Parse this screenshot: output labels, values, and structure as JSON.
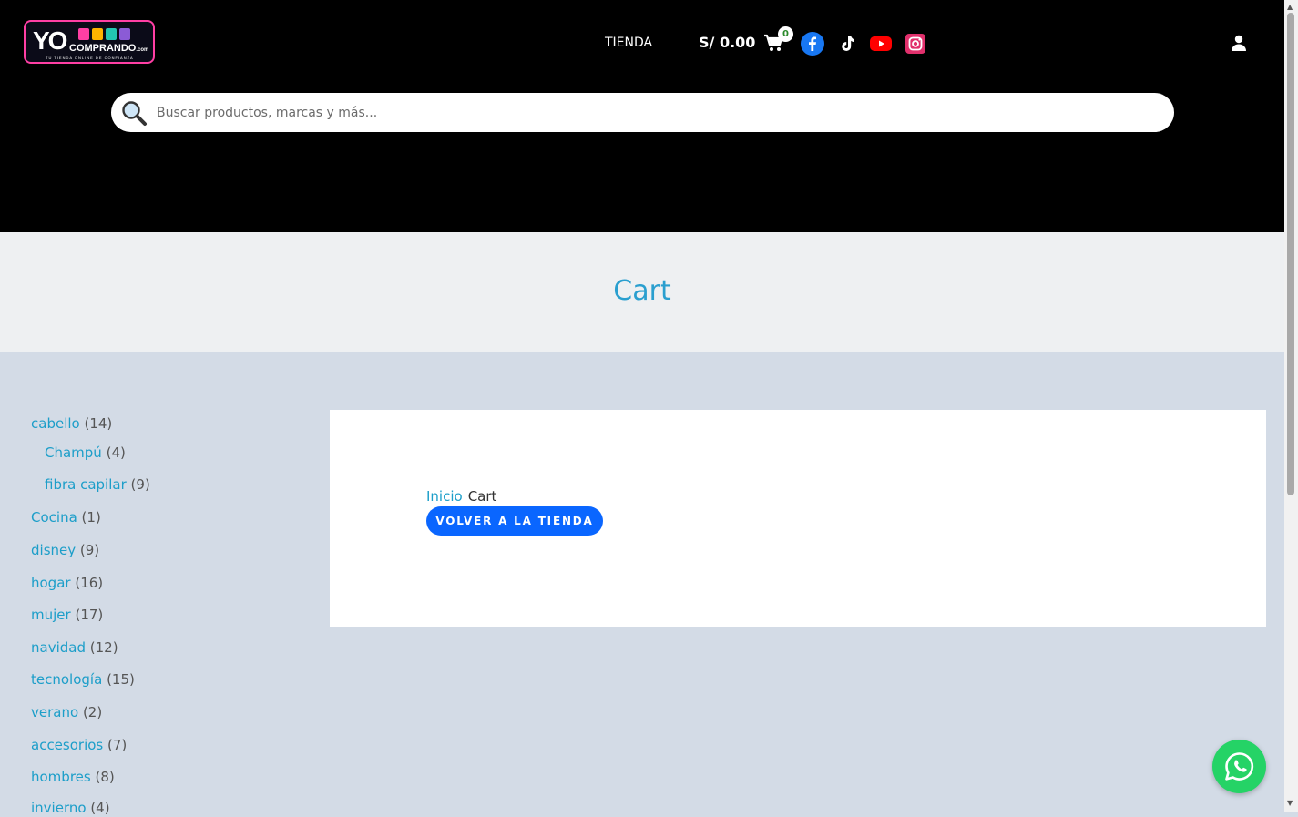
{
  "header": {
    "logo": {
      "wordmark": "YO",
      "brand": "COMPRANDO",
      "domain": ".com",
      "tagline": "TU TIENDA ONLINE DE CONFIANZA"
    },
    "nav_shop_label": "TIENDA",
    "cart_total": "S/ 0.00",
    "cart_count": "0",
    "social_icons": [
      "facebook-icon",
      "tiktok-icon",
      "youtube-icon",
      "instagram-icon"
    ],
    "search": {
      "placeholder": "Buscar productos, marcas y más..."
    }
  },
  "page_title": "Cart",
  "sidebar": {
    "categories": [
      {
        "name": "cabello",
        "count": "(14)",
        "level": 0
      },
      {
        "name": "Champú",
        "count": "(4)",
        "level": 1
      },
      {
        "name": "fibra capilar",
        "count": "(9)",
        "level": 1
      },
      {
        "name": "Cocina",
        "count": "(1)",
        "level": 0
      },
      {
        "name": "disney",
        "count": "(9)",
        "level": 0
      },
      {
        "name": "hogar",
        "count": "(16)",
        "level": 0
      },
      {
        "name": "mujer",
        "count": "(17)",
        "level": 0
      },
      {
        "name": "navidad",
        "count": "(12)",
        "level": 0
      },
      {
        "name": "tecnología",
        "count": "(15)",
        "level": 0
      },
      {
        "name": "verano",
        "count": "(2)",
        "level": 0
      },
      {
        "name": "accesorios",
        "count": "(7)",
        "level": 0
      },
      {
        "name": "hombres",
        "count": "(8)",
        "level": 0
      },
      {
        "name": "invierno",
        "count": "(4)",
        "level": 0
      }
    ]
  },
  "main": {
    "breadcrumb": {
      "home": "Inicio",
      "current": "Cart"
    },
    "back_button": "VOLVER A LA TIENDA"
  },
  "colors": {
    "accent": "#1c9ec9",
    "button": "#0a66ff",
    "whatsapp": "#25d366",
    "header_bg": "#000000",
    "logo_border": "#ff3fa4"
  }
}
